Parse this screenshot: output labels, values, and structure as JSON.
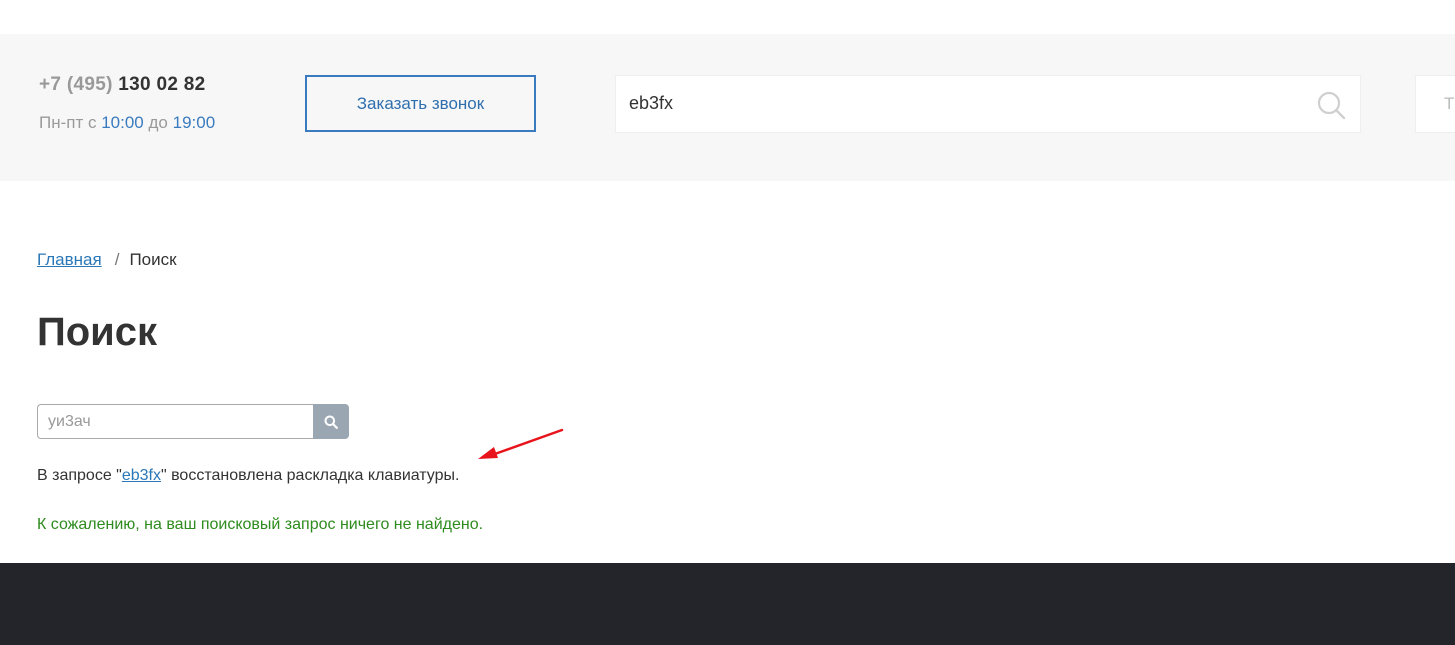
{
  "header": {
    "phone_code": "+7 (495)",
    "phone_number": "130 02 82",
    "hours_prefix": "Пн-пт с",
    "hours_from": "10:00",
    "hours_mid": "до",
    "hours_to": "19:00",
    "callback_label": "Заказать звонок",
    "search_value": "eb3fx",
    "partial_text": "Т"
  },
  "breadcrumb": {
    "home": "Главная",
    "separator": "/",
    "current": "Поиск"
  },
  "main": {
    "title": "Поиск",
    "search_placeholder": "уи3ач",
    "note_prefix": "В запросе \"",
    "note_link": "eb3fx",
    "note_suffix": "\" восстановлена раскладка клавиатуры.",
    "not_found": "К сожалению, на ваш поисковый запрос ничего не найдено."
  },
  "colors": {
    "accent": "#3a7bbf",
    "link": "#2a77b7",
    "success": "#2e8b1e",
    "footer": "#24252a",
    "header_bg": "#f7f7f7",
    "annotation_arrow": "#e8141c"
  },
  "icons": {
    "top_search": "search-icon",
    "form_search": "search-icon"
  }
}
